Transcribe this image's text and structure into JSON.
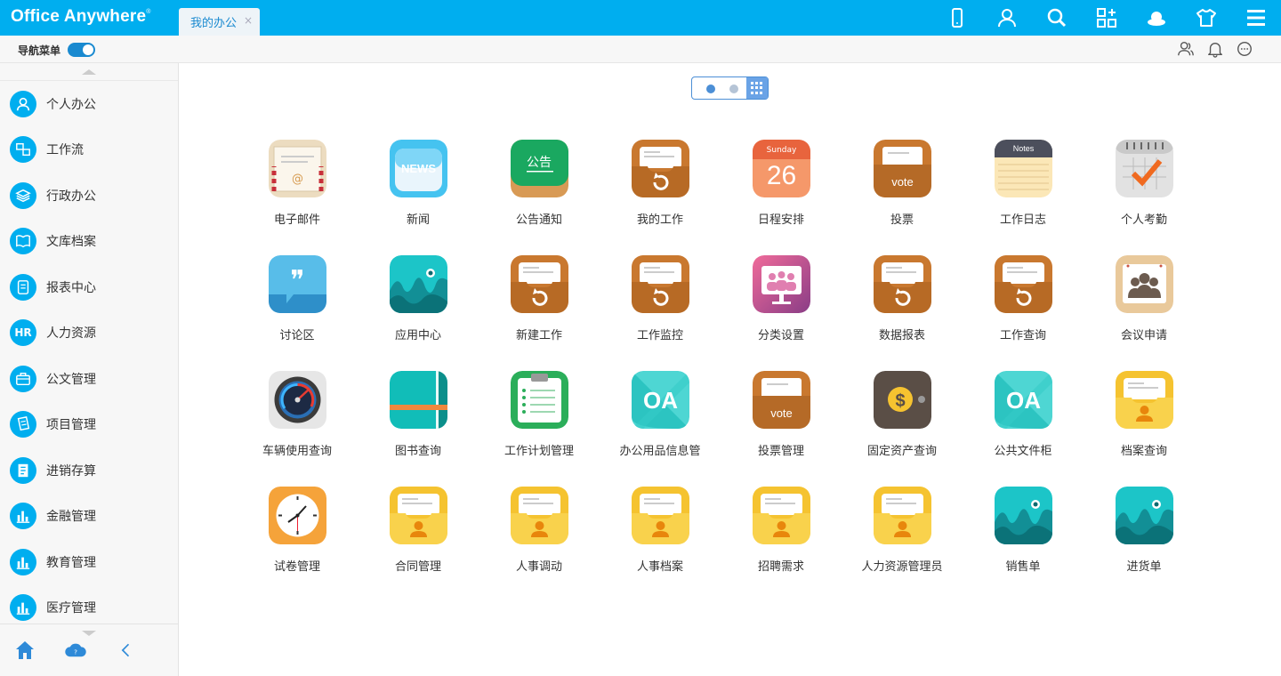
{
  "header": {
    "logo": "Office Anywhere",
    "logo_mark": "®",
    "tab_label": "我的办公",
    "tab_close": "×",
    "icons": [
      "mobile-icon",
      "user-icon",
      "search-icon",
      "apps-icon",
      "skin-icon",
      "theme-icon",
      "menu-icon"
    ]
  },
  "subbar": {
    "nav_label": "导航菜单",
    "icons": [
      "contacts-icon",
      "bell-icon",
      "chat-icon"
    ]
  },
  "sidebar": {
    "items": [
      {
        "label": "个人办公",
        "icon": "person-icon"
      },
      {
        "label": "工作流",
        "icon": "workflow-icon"
      },
      {
        "label": "行政办公",
        "icon": "layers-icon"
      },
      {
        "label": "文库档案",
        "icon": "book-icon"
      },
      {
        "label": "报表中心",
        "icon": "report-icon"
      },
      {
        "label": "人力资源",
        "icon": "hr-icon",
        "glyph": "HR"
      },
      {
        "label": "公文管理",
        "icon": "briefcase-icon"
      },
      {
        "label": "项目管理",
        "icon": "project-icon"
      },
      {
        "label": "进销存算",
        "icon": "ledger-icon"
      },
      {
        "label": "金融管理",
        "icon": "bar-chart-icon"
      },
      {
        "label": "教育管理",
        "icon": "bar-chart-icon"
      },
      {
        "label": "医疗管理",
        "icon": "bar-chart-icon"
      }
    ],
    "bottom_icons": [
      "home-icon",
      "cloud-help-icon",
      "collapse-icon"
    ],
    "cloud_glyph": "?"
  },
  "pager": {
    "pages": 2,
    "current": 1
  },
  "apps": [
    {
      "label": "电子邮件",
      "icon": "mail"
    },
    {
      "label": "新闻",
      "icon": "news",
      "text": "NEWS"
    },
    {
      "label": "公告通知",
      "icon": "board",
      "text": "公告"
    },
    {
      "label": "我的工作",
      "icon": "tray-orange"
    },
    {
      "label": "日程安排",
      "icon": "calendar",
      "text": "26",
      "subtext": "Sunday"
    },
    {
      "label": "投票",
      "icon": "vote",
      "text": "vote"
    },
    {
      "label": "工作日志",
      "icon": "notes",
      "text": "Notes"
    },
    {
      "label": "个人考勤",
      "icon": "check-calendar"
    },
    {
      "label": "讨论区",
      "icon": "quote",
      "text": "❞"
    },
    {
      "label": "应用中心",
      "icon": "wave"
    },
    {
      "label": "新建工作",
      "icon": "tray-orange"
    },
    {
      "label": "工作监控",
      "icon": "tray-orange"
    },
    {
      "label": "分类设置",
      "icon": "meeting-screen"
    },
    {
      "label": "数据报表",
      "icon": "tray-orange"
    },
    {
      "label": "工作查询",
      "icon": "tray-orange"
    },
    {
      "label": "会议申请",
      "icon": "meeting-board"
    },
    {
      "label": "车辆使用查询",
      "icon": "gauge"
    },
    {
      "label": "图书查询",
      "icon": "book"
    },
    {
      "label": "工作计划管理",
      "icon": "clipboard"
    },
    {
      "label": "办公用品信息管",
      "icon": "oa",
      "text": "OA"
    },
    {
      "label": "投票管理",
      "icon": "vote",
      "text": "vote"
    },
    {
      "label": "固定资产查询",
      "icon": "wallet",
      "text": "$"
    },
    {
      "label": "公共文件柜",
      "icon": "oa",
      "text": "OA"
    },
    {
      "label": "档案查询",
      "icon": "tray-yellow"
    },
    {
      "label": "试卷管理",
      "icon": "clock"
    },
    {
      "label": "合同管理",
      "icon": "tray-yellow"
    },
    {
      "label": "人事调动",
      "icon": "tray-yellow"
    },
    {
      "label": "人事档案",
      "icon": "tray-yellow"
    },
    {
      "label": "招聘需求",
      "icon": "tray-yellow"
    },
    {
      "label": "人力资源管理员",
      "icon": "tray-yellow"
    },
    {
      "label": "销售单",
      "icon": "wave"
    },
    {
      "label": "进货单",
      "icon": "wave"
    }
  ],
  "colors": {
    "brand": "#00aeef",
    "tray_orange": "#c9782f",
    "tray_yellow": "#f5c330",
    "teal": "#1cc5c8"
  }
}
